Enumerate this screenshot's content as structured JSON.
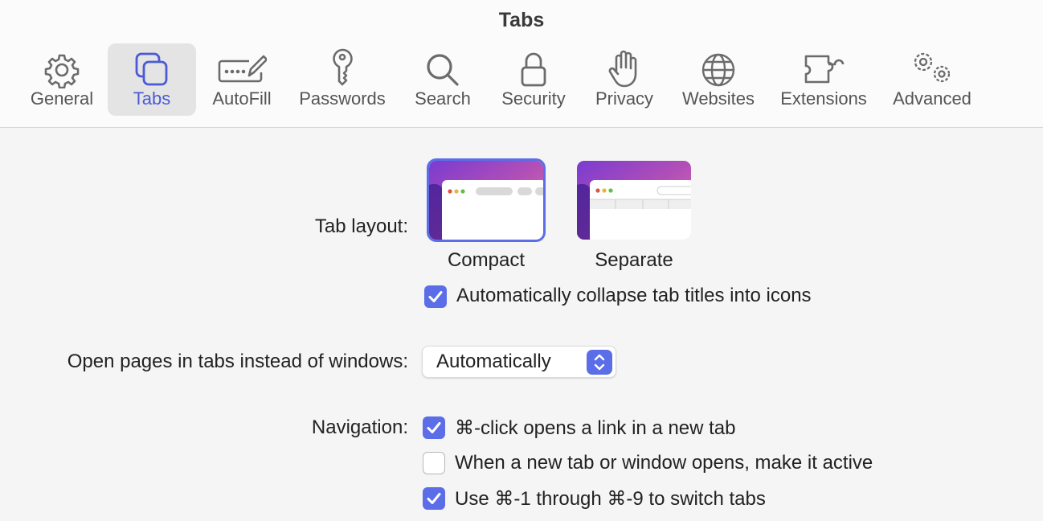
{
  "window": {
    "title": "Tabs"
  },
  "toolbar": {
    "items": [
      {
        "label": "General",
        "icon": "gear-icon"
      },
      {
        "label": "Tabs",
        "icon": "tabs-icon"
      },
      {
        "label": "AutoFill",
        "icon": "autofill-icon"
      },
      {
        "label": "Passwords",
        "icon": "key-icon"
      },
      {
        "label": "Search",
        "icon": "search-icon"
      },
      {
        "label": "Security",
        "icon": "lock-icon"
      },
      {
        "label": "Privacy",
        "icon": "hand-icon"
      },
      {
        "label": "Websites",
        "icon": "globe-icon"
      },
      {
        "label": "Extensions",
        "icon": "puzzle-icon"
      },
      {
        "label": "Advanced",
        "icon": "gears-icon"
      }
    ],
    "selected": "Tabs"
  },
  "tab_layout": {
    "label": "Tab layout:",
    "options": [
      {
        "caption": "Compact",
        "selected": true
      },
      {
        "caption": "Separate",
        "selected": false
      }
    ],
    "collapse_titles": {
      "label": "Automatically collapse tab titles into icons",
      "checked": true
    }
  },
  "open_pages": {
    "label": "Open pages in tabs instead of windows:",
    "value": "Automatically"
  },
  "navigation": {
    "label": "Navigation:",
    "options": [
      {
        "label": "⌘-click opens a link in a new tab",
        "checked": true
      },
      {
        "label": "When a new tab or window opens, make it active",
        "checked": false
      },
      {
        "label": "Use ⌘-1 through ⌘-9 to switch tabs",
        "checked": true
      }
    ]
  },
  "colors": {
    "accent": "#5b6ee8",
    "selected_tab_label": "#4a5bd5",
    "icon_gray": "#6b6b6b"
  }
}
